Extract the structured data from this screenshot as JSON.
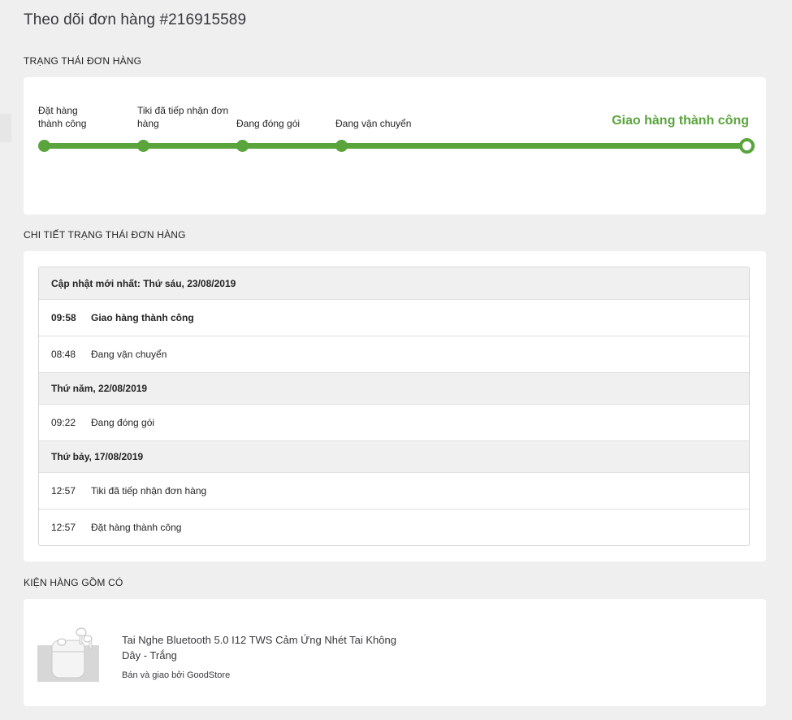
{
  "page": {
    "title": "Theo dõi đơn hàng #216915589"
  },
  "order_status": {
    "heading": "TRẠNG THÁI ĐƠN HÀNG",
    "steps": [
      {
        "line1": "Đặt hàng",
        "line2": "thành công"
      },
      {
        "line1": "Tiki đã tiếp nhận đơn",
        "line2": "hàng"
      },
      {
        "line1": "",
        "line2": "Đang đóng gói"
      },
      {
        "line1": "",
        "line2": "Đang vận chuyển"
      }
    ],
    "final_step": "Giao hàng thành công",
    "accent_color": "#59a43b"
  },
  "status_detail": {
    "heading": "CHI TIẾT TRẠNG THÁI ĐƠN HÀNG",
    "groups": [
      {
        "date": "Cập nhật mới nhất: Thứ sáu, 23/08/2019",
        "events": [
          {
            "time": "09:58",
            "text": "Giao hàng thành công"
          },
          {
            "time": "08:48",
            "text": "Đang vận chuyển"
          }
        ]
      },
      {
        "date": "Thứ năm, 22/08/2019",
        "events": [
          {
            "time": "09:22",
            "text": "Đang đóng gói"
          }
        ]
      },
      {
        "date": "Thứ bảy, 17/08/2019",
        "events": [
          {
            "time": "12:57",
            "text": "Tiki đã tiếp nhận đơn hàng"
          },
          {
            "time": "12:57",
            "text": "Đặt hàng thành công"
          }
        ]
      }
    ]
  },
  "package": {
    "heading": "KIỆN HÀNG GỒM CÓ",
    "product": {
      "image_icon": "earbuds-image",
      "name": "Tai Nghe Bluetooth 5.0 I12 TWS Cảm Ứng Nhét Tai Không Dây - Trắng",
      "seller": "Bán và giao bởi GoodStore"
    }
  }
}
